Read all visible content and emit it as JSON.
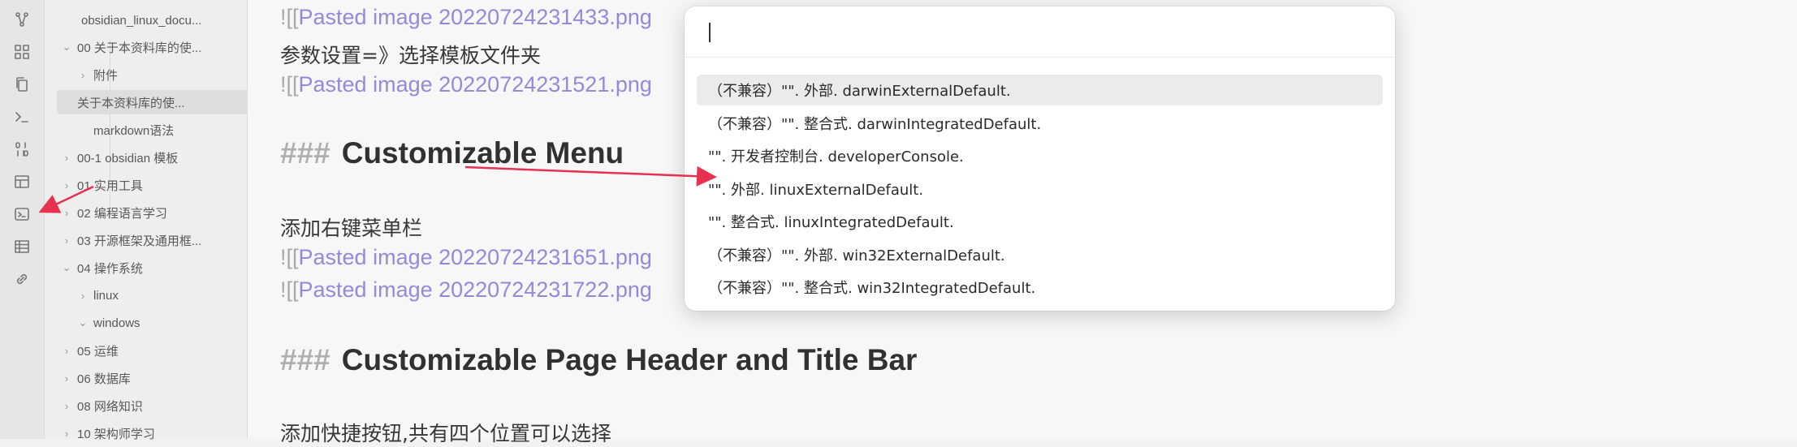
{
  "ribbon": {
    "icons": [
      "graph-icon",
      "grid-icon",
      "copy-icon",
      "terminal-icon",
      "binary-icon",
      "layout-icon",
      "console-icon",
      "table-icon",
      "link-icon"
    ]
  },
  "explorer": {
    "vault_name": "obsidian_linux_docu...",
    "items": [
      {
        "label": "00 关于本资料库的使...",
        "chevron": "⌄",
        "level": 0
      },
      {
        "label": "附件",
        "chevron": "›",
        "level": 1
      },
      {
        "label": "关于本资料库的使...",
        "chevron": "",
        "level": 1,
        "active": true
      },
      {
        "label": "markdown语法",
        "chevron": "",
        "level": 1
      },
      {
        "label": "00-1 obsidian 模板",
        "chevron": "›",
        "level": 0
      },
      {
        "label": "01 实用工具",
        "chevron": "›",
        "level": 0
      },
      {
        "label": "02 编程语言学习",
        "chevron": "›",
        "level": 0
      },
      {
        "label": "03 开源框架及通用框...",
        "chevron": "›",
        "level": 0
      },
      {
        "label": "04 操作系统",
        "chevron": "⌄",
        "level": 0
      },
      {
        "label": "linux",
        "chevron": "›",
        "level": 1
      },
      {
        "label": "windows",
        "chevron": "⌄",
        "level": 1
      },
      {
        "label": "05 运维",
        "chevron": "›",
        "level": 0
      },
      {
        "label": "06 数据库",
        "chevron": "›",
        "level": 0
      },
      {
        "label": "08 网络知识",
        "chevron": "›",
        "level": 0
      },
      {
        "label": "10 架构师学习",
        "chevron": "›",
        "level": 0
      }
    ]
  },
  "editor": {
    "link1_prefix": "![[",
    "link1": "Pasted image 20220724231433.png",
    "text1": "参数设置=》选择模板文件夹",
    "link2_prefix": "![[",
    "link2": "Pasted image 20220724231521.png",
    "heading1_hash": "###",
    "heading1": "Customizable  Menu",
    "text2": "添加右键菜单栏",
    "link3_prefix": "![[",
    "link3": "Pasted image 20220724231651.png",
    "link4_prefix": "![[",
    "link4": "Pasted image 20220724231722.png",
    "heading2_hash": "###",
    "heading2": "Customizable Page Header and Title Bar",
    "text3": "添加快捷按钮,共有四个位置可以选择"
  },
  "palette": {
    "search_value": "",
    "commands": [
      "（不兼容）\"\". 外部. darwinExternalDefault.",
      "（不兼容）\"\". 整合式. darwinIntegratedDefault.",
      "\"\". 开发者控制台. developerConsole.",
      "\"\". 外部. linuxExternalDefault.",
      "\"\". 整合式. linuxIntegratedDefault.",
      "（不兼容）\"\". 外部. win32ExternalDefault.",
      "（不兼容）\"\". 整合式. win32IntegratedDefault."
    ],
    "selected_index": 0
  },
  "colors": {
    "link": "#9a8ee3",
    "annotation_arrow": "#e8314f",
    "selected_bg": "#ebebeb"
  }
}
